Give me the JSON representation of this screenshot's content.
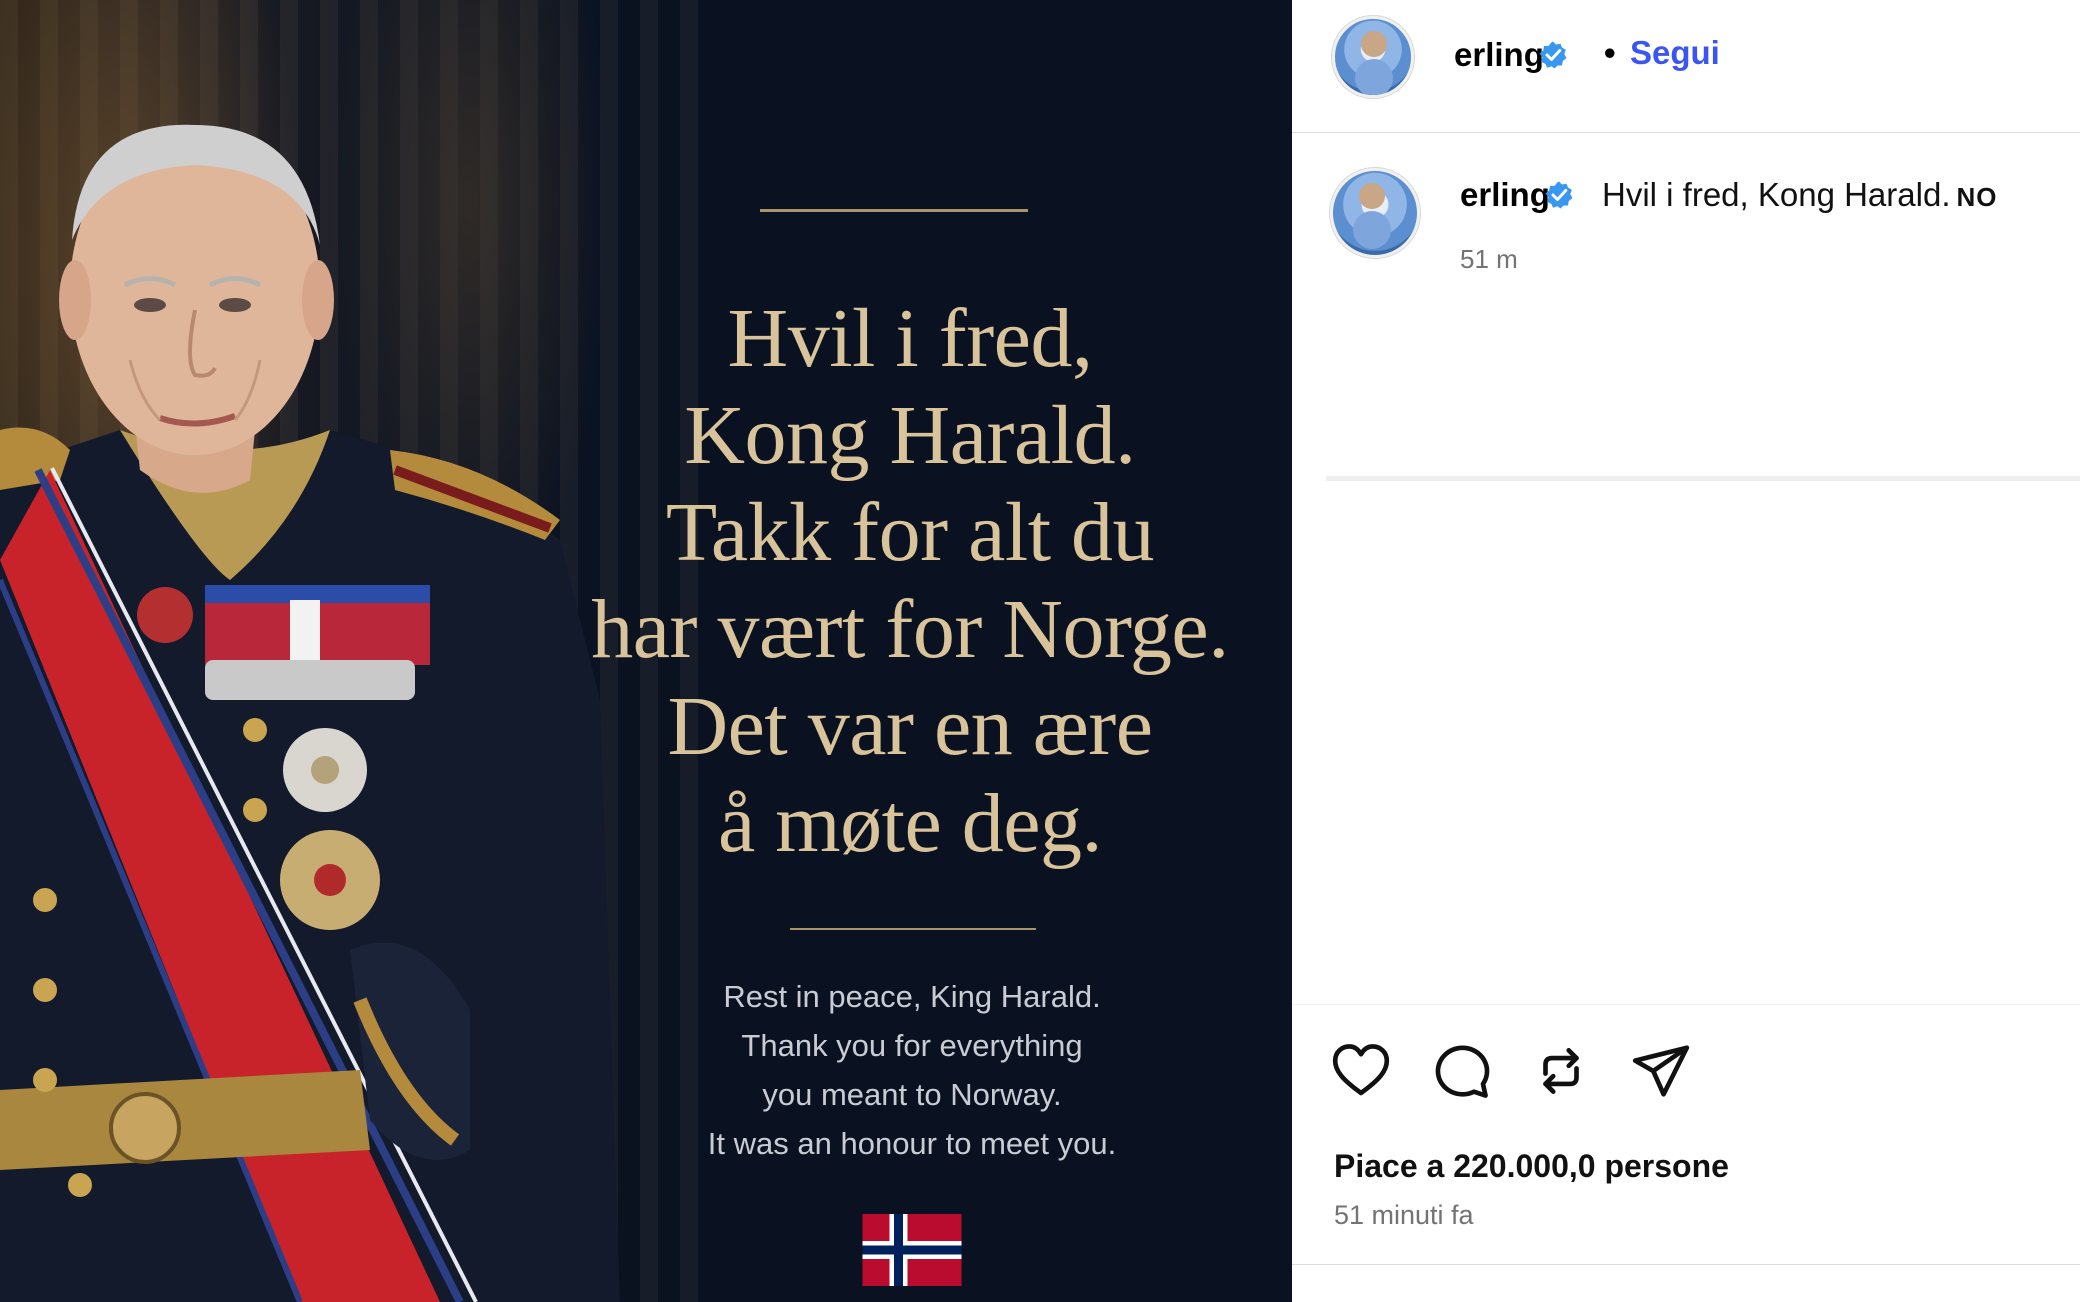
{
  "post_image": {
    "norwegian_lines": [
      "Hvil i fred,",
      "Kong Harald.",
      "Takk for alt du",
      "har vært for Norge.",
      "Det var en ære",
      "å møte deg."
    ],
    "english_lines": [
      "Rest in peace, King Harald.",
      "Thank you for everything",
      "you meant to Norway.",
      "It was an honour to meet you."
    ],
    "colors": {
      "background": "#0a1222",
      "gold_text": "#d9c39a",
      "english_text": "#c9ccd3"
    }
  },
  "header": {
    "username": "erling",
    "separator": "•",
    "follow_label": "Segui"
  },
  "caption": {
    "username": "erling",
    "text": "Hvil i fred, Kong Harald.",
    "flag_code": "NO",
    "time": "51 m"
  },
  "actions": {
    "icons": [
      "heart-icon",
      "comment-icon",
      "repost-icon",
      "share-icon"
    ]
  },
  "likes_text": "Piace a 220.000,0 persone",
  "posted_text": "51 minuti fa",
  "colors": {
    "follow": "#3b55f3",
    "verified": "#3897f0",
    "secondary_text": "#737373"
  }
}
